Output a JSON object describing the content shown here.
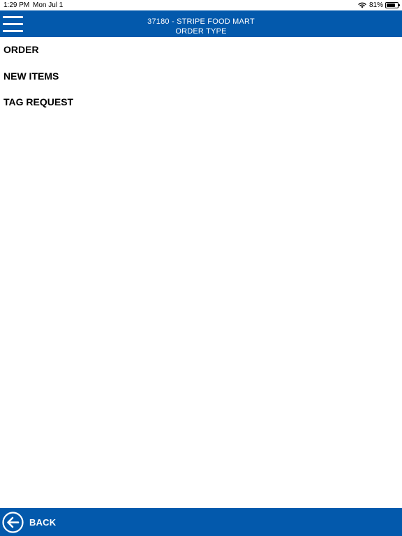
{
  "status_bar": {
    "time": "1:29 PM",
    "date": "Mon Jul 1",
    "battery_percent_text": "81%",
    "battery_level": 0.81,
    "wifi_icon": "wifi-icon",
    "battery_icon": "battery-icon"
  },
  "header": {
    "store": "37180 - STRIPE FOOD MART",
    "title": "ORDER TYPE",
    "menu_icon": "hamburger-menu-icon"
  },
  "menu": {
    "items": [
      {
        "label": "ORDER"
      },
      {
        "label": "NEW ITEMS"
      },
      {
        "label": "TAG REQUEST"
      }
    ]
  },
  "footer": {
    "back_label": "BACK",
    "back_icon": "back-arrow-circle-icon"
  },
  "colors": {
    "brand": "#0359ac",
    "text": "#000000",
    "background": "#ffffff"
  }
}
